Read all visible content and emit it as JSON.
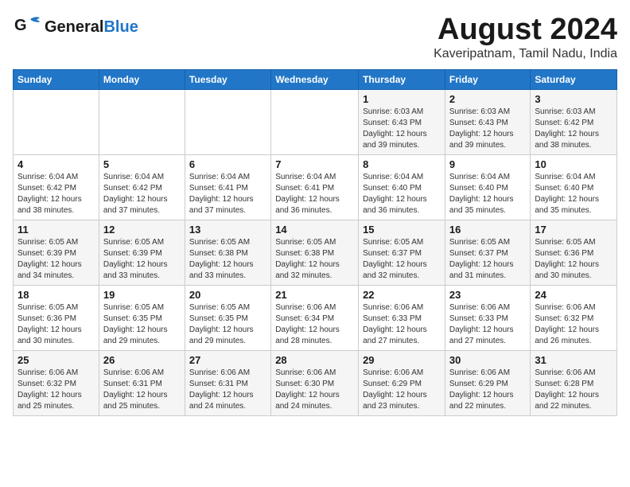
{
  "header": {
    "logo_line1": "General",
    "logo_line2": "Blue",
    "title": "August 2024",
    "location": "Kaveripatnam, Tamil Nadu, India"
  },
  "weekdays": [
    "Sunday",
    "Monday",
    "Tuesday",
    "Wednesday",
    "Thursday",
    "Friday",
    "Saturday"
  ],
  "weeks": [
    [
      {
        "day": "",
        "info": ""
      },
      {
        "day": "",
        "info": ""
      },
      {
        "day": "",
        "info": ""
      },
      {
        "day": "",
        "info": ""
      },
      {
        "day": "1",
        "info": "Sunrise: 6:03 AM\nSunset: 6:43 PM\nDaylight: 12 hours\nand 39 minutes."
      },
      {
        "day": "2",
        "info": "Sunrise: 6:03 AM\nSunset: 6:43 PM\nDaylight: 12 hours\nand 39 minutes."
      },
      {
        "day": "3",
        "info": "Sunrise: 6:03 AM\nSunset: 6:42 PM\nDaylight: 12 hours\nand 38 minutes."
      }
    ],
    [
      {
        "day": "4",
        "info": "Sunrise: 6:04 AM\nSunset: 6:42 PM\nDaylight: 12 hours\nand 38 minutes."
      },
      {
        "day": "5",
        "info": "Sunrise: 6:04 AM\nSunset: 6:42 PM\nDaylight: 12 hours\nand 37 minutes."
      },
      {
        "day": "6",
        "info": "Sunrise: 6:04 AM\nSunset: 6:41 PM\nDaylight: 12 hours\nand 37 minutes."
      },
      {
        "day": "7",
        "info": "Sunrise: 6:04 AM\nSunset: 6:41 PM\nDaylight: 12 hours\nand 36 minutes."
      },
      {
        "day": "8",
        "info": "Sunrise: 6:04 AM\nSunset: 6:40 PM\nDaylight: 12 hours\nand 36 minutes."
      },
      {
        "day": "9",
        "info": "Sunrise: 6:04 AM\nSunset: 6:40 PM\nDaylight: 12 hours\nand 35 minutes."
      },
      {
        "day": "10",
        "info": "Sunrise: 6:04 AM\nSunset: 6:40 PM\nDaylight: 12 hours\nand 35 minutes."
      }
    ],
    [
      {
        "day": "11",
        "info": "Sunrise: 6:05 AM\nSunset: 6:39 PM\nDaylight: 12 hours\nand 34 minutes."
      },
      {
        "day": "12",
        "info": "Sunrise: 6:05 AM\nSunset: 6:39 PM\nDaylight: 12 hours\nand 33 minutes."
      },
      {
        "day": "13",
        "info": "Sunrise: 6:05 AM\nSunset: 6:38 PM\nDaylight: 12 hours\nand 33 minutes."
      },
      {
        "day": "14",
        "info": "Sunrise: 6:05 AM\nSunset: 6:38 PM\nDaylight: 12 hours\nand 32 minutes."
      },
      {
        "day": "15",
        "info": "Sunrise: 6:05 AM\nSunset: 6:37 PM\nDaylight: 12 hours\nand 32 minutes."
      },
      {
        "day": "16",
        "info": "Sunrise: 6:05 AM\nSunset: 6:37 PM\nDaylight: 12 hours\nand 31 minutes."
      },
      {
        "day": "17",
        "info": "Sunrise: 6:05 AM\nSunset: 6:36 PM\nDaylight: 12 hours\nand 30 minutes."
      }
    ],
    [
      {
        "day": "18",
        "info": "Sunrise: 6:05 AM\nSunset: 6:36 PM\nDaylight: 12 hours\nand 30 minutes."
      },
      {
        "day": "19",
        "info": "Sunrise: 6:05 AM\nSunset: 6:35 PM\nDaylight: 12 hours\nand 29 minutes."
      },
      {
        "day": "20",
        "info": "Sunrise: 6:05 AM\nSunset: 6:35 PM\nDaylight: 12 hours\nand 29 minutes."
      },
      {
        "day": "21",
        "info": "Sunrise: 6:06 AM\nSunset: 6:34 PM\nDaylight: 12 hours\nand 28 minutes."
      },
      {
        "day": "22",
        "info": "Sunrise: 6:06 AM\nSunset: 6:33 PM\nDaylight: 12 hours\nand 27 minutes."
      },
      {
        "day": "23",
        "info": "Sunrise: 6:06 AM\nSunset: 6:33 PM\nDaylight: 12 hours\nand 27 minutes."
      },
      {
        "day": "24",
        "info": "Sunrise: 6:06 AM\nSunset: 6:32 PM\nDaylight: 12 hours\nand 26 minutes."
      }
    ],
    [
      {
        "day": "25",
        "info": "Sunrise: 6:06 AM\nSunset: 6:32 PM\nDaylight: 12 hours\nand 25 minutes."
      },
      {
        "day": "26",
        "info": "Sunrise: 6:06 AM\nSunset: 6:31 PM\nDaylight: 12 hours\nand 25 minutes."
      },
      {
        "day": "27",
        "info": "Sunrise: 6:06 AM\nSunset: 6:31 PM\nDaylight: 12 hours\nand 24 minutes."
      },
      {
        "day": "28",
        "info": "Sunrise: 6:06 AM\nSunset: 6:30 PM\nDaylight: 12 hours\nand 24 minutes."
      },
      {
        "day": "29",
        "info": "Sunrise: 6:06 AM\nSunset: 6:29 PM\nDaylight: 12 hours\nand 23 minutes."
      },
      {
        "day": "30",
        "info": "Sunrise: 6:06 AM\nSunset: 6:29 PM\nDaylight: 12 hours\nand 22 minutes."
      },
      {
        "day": "31",
        "info": "Sunrise: 6:06 AM\nSunset: 6:28 PM\nDaylight: 12 hours\nand 22 minutes."
      }
    ]
  ]
}
